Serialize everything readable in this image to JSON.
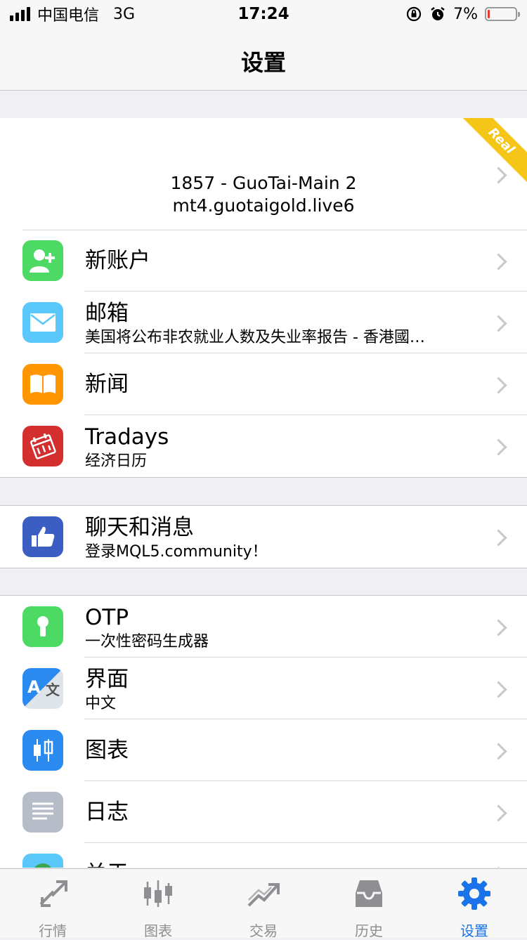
{
  "status_bar": {
    "carrier": "中国电信",
    "network": "3G",
    "time": "17:24",
    "battery": "7%",
    "battery_level": 0.07,
    "battery_color": "#e53935"
  },
  "nav": {
    "title": "设置"
  },
  "account": {
    "line1": "1857          - GuoTai-Main 2",
    "line2": "mt4.guotaigold.live6",
    "badge": "Real",
    "badge_color": "#f5c518"
  },
  "groups": [
    {
      "items": [
        {
          "icon": "add-user-icon",
          "color": "#4cd964",
          "title": "新账户"
        },
        {
          "icon": "mail-icon",
          "color": "#5ac8fa",
          "title": "邮箱",
          "subtitle": "美国将公布非农就业人数及失业率报告 - 香港國…"
        },
        {
          "icon": "book-icon",
          "color": "#ff9500",
          "title": "新闻"
        },
        {
          "icon": "calendar-icon",
          "color": "#d32f2f",
          "title": "Tradays",
          "subtitle": "经济日历"
        }
      ]
    },
    {
      "items": [
        {
          "icon": "thumbs-up-icon",
          "color": "#3b5ec2",
          "title": "聊天和消息",
          "subtitle": "登录MQL5.community！"
        }
      ]
    },
    {
      "items": [
        {
          "icon": "keyhole-icon",
          "color": "#4cd964",
          "title": "OTP",
          "subtitle": "一次性密码生成器"
        },
        {
          "icon": "translate-icon",
          "color": "#2a8af0",
          "title": "界面",
          "subtitle": "中文"
        },
        {
          "icon": "candlestick-icon",
          "color": "#2a8af0",
          "title": "图表"
        },
        {
          "icon": "journal-icon",
          "color": "#b6bcc8",
          "title": "日志"
        },
        {
          "icon": "about-icon",
          "color": "#5ac8fa",
          "title": "关于"
        }
      ]
    }
  ],
  "tabs": [
    {
      "label": "行情",
      "icon": "quotes-icon"
    },
    {
      "label": "图表",
      "icon": "chart-icon"
    },
    {
      "label": "交易",
      "icon": "trade-icon"
    },
    {
      "label": "历史",
      "icon": "history-icon"
    },
    {
      "label": "设置",
      "icon": "gear-icon",
      "active": true
    }
  ],
  "colors": {
    "accent": "#1a73e8",
    "inactive": "#8e8e93"
  }
}
